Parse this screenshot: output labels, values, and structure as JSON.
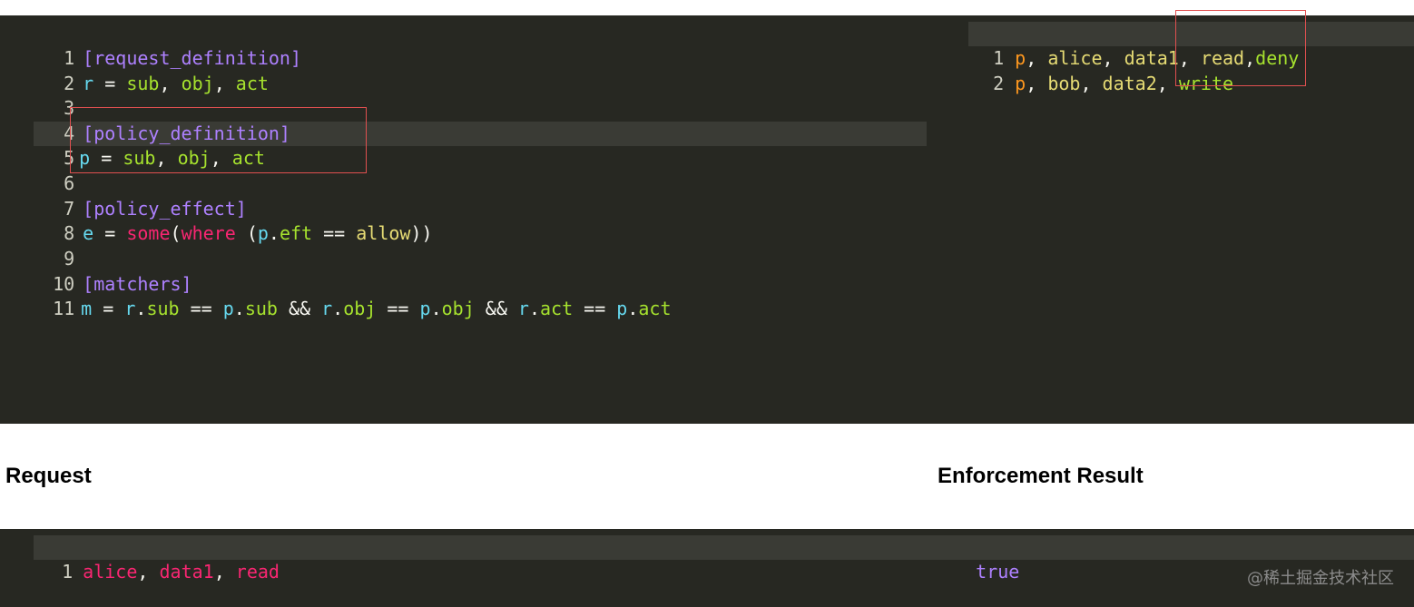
{
  "model_editor": {
    "line_numbers": [
      "1",
      "2",
      "3",
      "4",
      "5",
      "6",
      "7",
      "8",
      "9",
      "10",
      "11"
    ],
    "lines": {
      "l1": "[request_definition]",
      "l2_var": "r",
      "l2_eq": " = ",
      "l2_a": "sub",
      "l2_c1": ", ",
      "l2_b": "obj",
      "l2_c2": ", ",
      "l2_c": "act",
      "l4": "[policy_definition]",
      "l5_var": "p",
      "l5_eq": " = ",
      "l5_a": "sub",
      "l5_c1": ", ",
      "l5_b": "obj",
      "l5_c2": ", ",
      "l5_c": "act",
      "l7": "[policy_effect]",
      "l8_var": "e",
      "l8_eq": " = ",
      "l8_fn": "some",
      "l8_p1": "(",
      "l8_kw": "where",
      "l8_sp": " (",
      "l8_p": "p",
      "l8_dot": ".",
      "l8_eft": "eft",
      "l8_op": " == ",
      "l8_allow": "allow",
      "l8_p2": "))",
      "l10": "[matchers]",
      "l11_m": "m",
      "l11_eq": " = ",
      "l11_r1": "r",
      "l11_d1": ".",
      "l11_f1": "sub",
      "l11_o1": " == ",
      "l11_p1": "p",
      "l11_d2": ".",
      "l11_f2": "sub",
      "l11_and1": " && ",
      "l11_r2": "r",
      "l11_d3": ".",
      "l11_f3": "obj",
      "l11_o2": " == ",
      "l11_p2": "p",
      "l11_d4": ".",
      "l11_f4": "obj",
      "l11_and2": " && ",
      "l11_r3": "r",
      "l11_d5": ".",
      "l11_f5": "act",
      "l11_o3": " == ",
      "l11_p3": "p",
      "l11_d6": ".",
      "l11_f6": "act"
    }
  },
  "policy_editor": {
    "line_numbers": [
      "1",
      "2"
    ],
    "rows": [
      {
        "p": "p",
        "c1": ", ",
        "sub": "alice",
        "c2": ", ",
        "obj": "data1",
        "c3": ", ",
        "act": "read",
        "c4": ",",
        "eft": "deny"
      },
      {
        "p": "p",
        "c1": ", ",
        "sub": "bob",
        "c2": ", ",
        "obj": "data2",
        "c3": ", ",
        "act": "write"
      }
    ]
  },
  "request_title": "Request",
  "result_title": "Enforcement Result",
  "request_editor": {
    "line_numbers": [
      "1"
    ],
    "row": {
      "a": "alice",
      "c1": ", ",
      "b": "data1",
      "c2": ", ",
      "c": "read"
    }
  },
  "result_editor": {
    "value": "true"
  },
  "watermark": "@稀土掘金技术社区",
  "colors": {
    "editor_bg": "#272822",
    "section": "#ae81ff",
    "variable": "#66d9ef",
    "field": "#a6e22e",
    "keyword": "#f92672",
    "string": "#e6db74",
    "highlight_box": "#e05050"
  }
}
